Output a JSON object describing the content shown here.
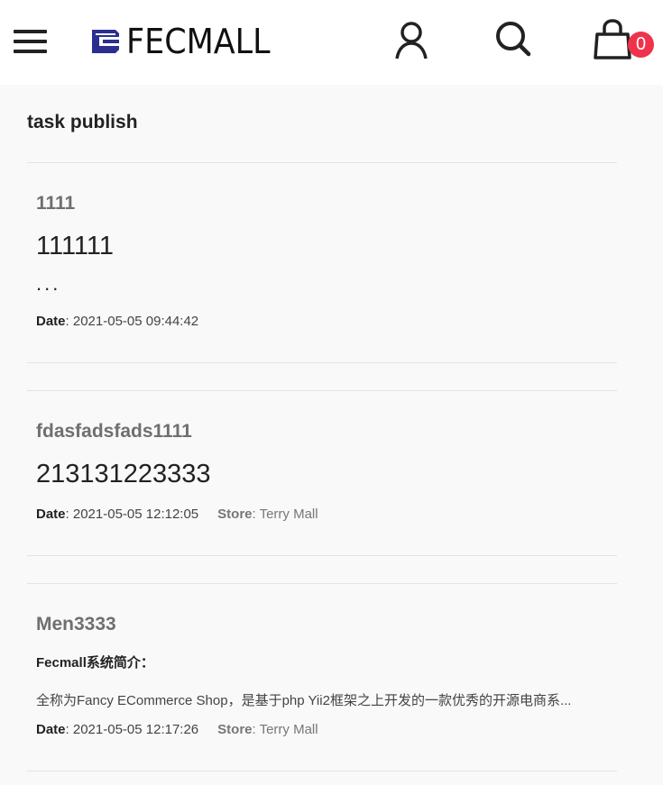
{
  "header": {
    "logo_text": "FECMALL",
    "cart_count": "0",
    "icons": [
      "menu-icon",
      "user-icon",
      "search-icon",
      "cart-icon"
    ],
    "brand_color": "#2b2f8f",
    "badge_color": "#f0334d"
  },
  "page": {
    "title": "task publish"
  },
  "posts": [
    {
      "title": "1111",
      "body": "111111",
      "ellipsis": "...",
      "date_label": "Date",
      "date": "2021-05-05 09:44:42"
    },
    {
      "title": "fdasfadsfads1111",
      "body": "213131223333",
      "date_label": "Date",
      "date": "2021-05-05 12:12:05",
      "store_label": "Store",
      "store": "Terry Mall"
    },
    {
      "title": "Men3333",
      "subhead": "Fecmall系统简介：",
      "desc": "全称为Fancy ECommerce Shop，是基于php Yii2框架之上开发的一款优秀的开源电商系...",
      "date_label": "Date",
      "date": "2021-05-05 12:17:26",
      "store_label": "Store",
      "store": "Terry Mall"
    }
  ]
}
